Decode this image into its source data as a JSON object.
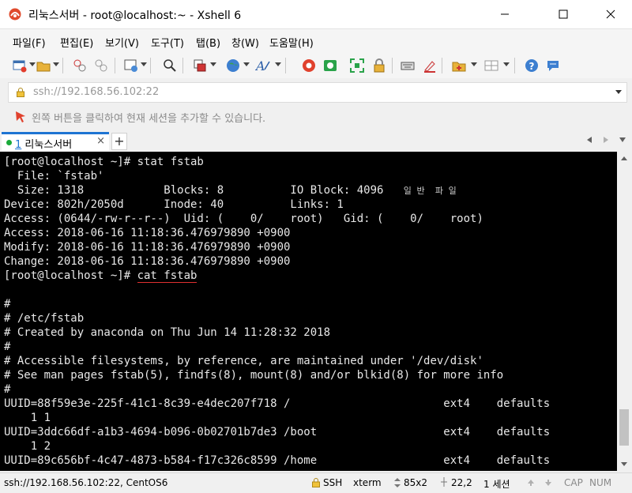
{
  "window": {
    "title": "리눅스서버 - root@localhost:~ - Xshell 6",
    "app_icon": "xshell-logo"
  },
  "menu": [
    "파일(F)",
    "편집(E)",
    "보기(V)",
    "도구(T)",
    "탭(B)",
    "창(W)",
    "도움말(H)"
  ],
  "address": {
    "value": "ssh://192.168.56.102:22"
  },
  "hint": {
    "text": "왼쪽 버튼을 클릭하여 현재 세션을 추가할 수 있습니다."
  },
  "tab": {
    "number": "1",
    "label": "리눅스서버",
    "close": "×",
    "add": "+"
  },
  "terminal": {
    "lines": [
      "[root@localhost ~]# stat fstab",
      "  File: `fstab'",
      "  Size: 1318            Blocks: 8          IO Block: 4096   ",
      "Device: 802h/2050d      Inode: 40          Links: 1",
      "Access: (0644/-rw-r--r--)  Uid: (    0/    root)   Gid: (    0/    root)",
      "Access: 2018-06-16 11:18:36.476979890 +0900",
      "Modify: 2018-06-16 11:18:36.476979890 +0900",
      "Change: 2018-06-16 11:18:36.476979890 +0900",
      "[root@localhost ~]# ",
      "",
      "#",
      "# /etc/fstab",
      "# Created by anaconda on Thu Jun 14 11:28:32 2018",
      "#",
      "# Accessible filesystems, by reference, are maintained under '/dev/disk'",
      "# See man pages fstab(5), findfs(8), mount(8) and/or blkid(8) for more info",
      "#",
      "UUID=88f59e3e-225f-41c1-8c39-e4dec207f718 /                       ext4    defaults",
      "    1 1",
      "UUID=3ddc66df-a1b3-4694-b096-0b02701b7de3 /boot                   ext4    defaults",
      "    1 2",
      "UUID=89c656bf-4c47-4873-b584-f17c326c8599 /home                   ext4    defaults"
    ],
    "underlined_command": "cat fstab",
    "ime_mode": "일 반  파 일"
  },
  "status": {
    "session": "ssh://192.168.56.102:22, CentOS6",
    "protocol": "SSH",
    "terminal_type": "xterm",
    "size": "85x2",
    "cursor": "22,2",
    "sessions": "1 세션",
    "caps": "CAP",
    "num": "NUM"
  },
  "colors": {
    "accent": "#1e74d2",
    "terminal_bg": "#000000",
    "terminal_fg": "#e8e8e8",
    "underline": "#e03030"
  }
}
